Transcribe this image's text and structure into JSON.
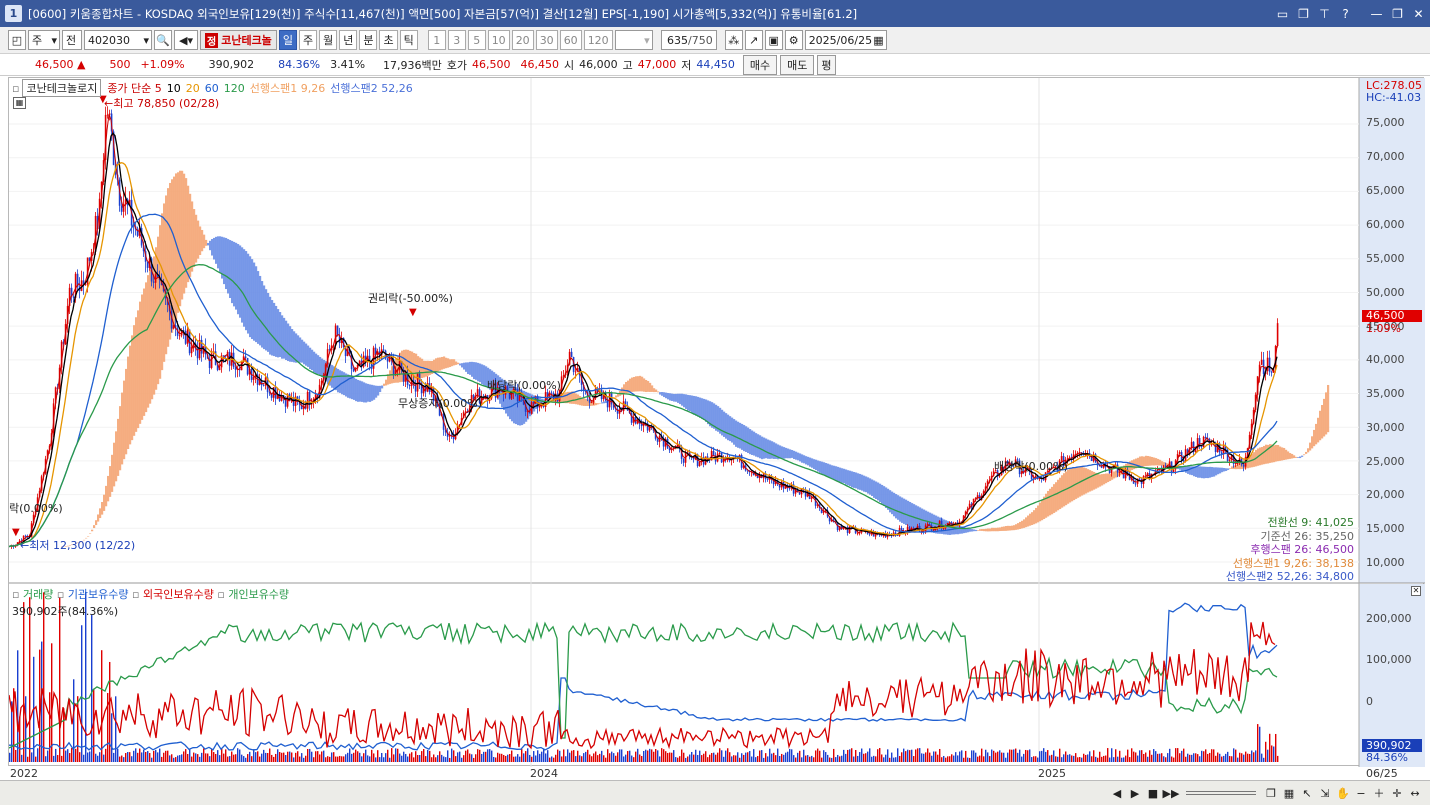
{
  "window": {
    "title": "[0600] 키움종합차트 - KOSDAQ 외국인보유[129(천)] 주식수[11,467(천)] 액면[500] 자본금[57(억)] 결산[12월] EPS[-1,190] 시가총액[5,332(억)] 유통비율[61.2]",
    "app_icon": "1"
  },
  "toolbar": {
    "mode": "주",
    "range": "전",
    "code": "402030",
    "stock_badge": "정",
    "stock_name": "코난테크놀",
    "periods": [
      "일",
      "주",
      "월",
      "년",
      "분",
      "초",
      "틱"
    ],
    "active_period": "일",
    "numbers": [
      "1",
      "3",
      "5",
      "10",
      "20",
      "30",
      "60",
      "120"
    ],
    "count": "635",
    "total": "/750",
    "date": "2025/06/25"
  },
  "quote": {
    "price": "46,500",
    "change": "500",
    "pct": "+1.09%",
    "volume": "390,902",
    "ratio": "84.36%",
    "turnover": "3.41%",
    "amount": "17,936백만",
    "ask_label": "호가",
    "ask1": "46,500",
    "ask2": "46,450",
    "open_label": "시",
    "open": "46,000",
    "high_label": "고",
    "high": "47,000",
    "low_label": "저",
    "low": "44,450",
    "buy": "매수",
    "sell": "매도",
    "eval": "평"
  },
  "price_legend": {
    "name": "코난테크놀로지",
    "items": [
      {
        "text": "종가 단순 5",
        "color": "#c80000"
      },
      {
        "text": "10",
        "color": "#000000"
      },
      {
        "text": "20",
        "color": "#e69500"
      },
      {
        "text": "60",
        "color": "#1f5fd0"
      },
      {
        "text": "120",
        "color": "#2a9a4a"
      },
      {
        "text": "선행스팬1 9,26",
        "color": "#f0a060"
      },
      {
        "text": "선행스팬2 52,26",
        "color": "#4a70d8"
      }
    ]
  },
  "price_axis": {
    "ticks": [
      "75,000",
      "70,000",
      "65,000",
      "60,000",
      "55,000",
      "50,000",
      "45,000",
      "40,000",
      "35,000",
      "30,000",
      "25,000",
      "20,000",
      "15,000",
      "10,000"
    ],
    "lc": "LC:278.05",
    "hc": "HC:-41.03",
    "current_tag": "46,500",
    "current_pct": "1.09%"
  },
  "annotations": {
    "high": "←최고 78,850 (02/28)",
    "low": "←최저 12,300 (12/22)",
    "rights": "권리락(-50.00%)",
    "paid_in": "무상증자(0.00%)",
    "dividend1": "배당락(0.00%)",
    "dividend2": "배당락(0.00%)",
    "left_edge": "락(0.00%)"
  },
  "ichimoku_panel": [
    {
      "text": "전환선 9: 41,025",
      "color": "#2a7a2a"
    },
    {
      "text": "기준선 26: 35,250",
      "color": "#666666"
    },
    {
      "text": "후행스팬 26: 46,500",
      "color": "#8a2ab0"
    },
    {
      "text": "선행스팬1 9,26: 38,138",
      "color": "#e08a3a"
    },
    {
      "text": "선행스팬2 52,26: 34,800",
      "color": "#3a5ac8"
    }
  ],
  "volume_legend": {
    "items": [
      {
        "text": "거래량",
        "color": "#2a9a4a"
      },
      {
        "text": "기관보유수량",
        "color": "#1f5fd0"
      },
      {
        "text": "외국인보유수량",
        "color": "#d40000"
      },
      {
        "text": "개인보유수량",
        "color": "#2a9a4a"
      }
    ],
    "sub": "390,902주(84.36%)"
  },
  "volume_axis": {
    "ticks": [
      "200,000",
      "100,000",
      "0"
    ],
    "tag": "390,902",
    "tag_pct": "84.36%"
  },
  "x_axis": {
    "labels": [
      "2022",
      "2024",
      "2025",
      "06/25"
    ]
  },
  "chart_data": {
    "type": "line",
    "title": "",
    "ylim": [
      10000,
      80000
    ],
    "series": [
      {
        "name": "종가",
        "values": [
          12300,
          78850,
          55000,
          45000,
          40000,
          35000,
          46000,
          36000,
          38000,
          34000,
          42000,
          33000,
          28000,
          22000,
          18000,
          14000,
          15000,
          14000,
          25000,
          22000,
          28000,
          24000,
          22000,
          27000,
          24000,
          46500
        ]
      }
    ]
  }
}
